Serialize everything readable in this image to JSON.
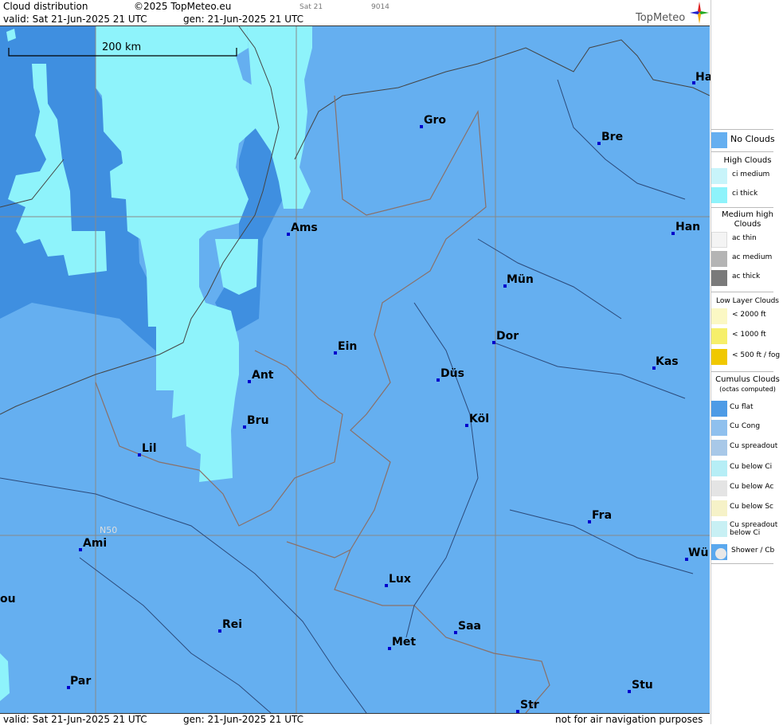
{
  "header": {
    "product": "Cloud distribution",
    "copyright": "©2025 TopMeteo.eu",
    "valid": "valid:  Sat  21-Jun-2025  21 UTC",
    "generated": "gen: 21-Jun-2025 21 UTC",
    "day_small": "Sat 21",
    "code_small": "9014",
    "brand": "TopMeteo"
  },
  "footer": {
    "valid": "valid:  Sat  21-Jun-2025  21 UTC",
    "generated": "gen: 21-Jun-2025 21 UTC",
    "disclaimer": "not for air navigation purposes"
  },
  "map": {
    "scale_label": "200 km",
    "latitude_label": "N50",
    "colors": {
      "no_clouds": "#65aff0",
      "ci_thick": "#8ef3fb",
      "deep": "#3f8fe0",
      "border": "#8a7068",
      "river": "#2c4a7a"
    },
    "cities": [
      {
        "name": "Ha"
      },
      {
        "name": "Gro"
      },
      {
        "name": "Bre"
      },
      {
        "name": "Ams"
      },
      {
        "name": "Han"
      },
      {
        "name": "Mün"
      },
      {
        "name": "Dor"
      },
      {
        "name": "Ein"
      },
      {
        "name": "Kas"
      },
      {
        "name": "Ant"
      },
      {
        "name": "Düs"
      },
      {
        "name": "Köl"
      },
      {
        "name": "Bru"
      },
      {
        "name": "Lil"
      },
      {
        "name": "Fra"
      },
      {
        "name": "Ami"
      },
      {
        "name": "Wü"
      },
      {
        "name": "Lux"
      },
      {
        "name": "ou"
      },
      {
        "name": "Rei"
      },
      {
        "name": "Saa"
      },
      {
        "name": "Met"
      },
      {
        "name": "Stu"
      },
      {
        "name": "Par"
      },
      {
        "name": "Str"
      }
    ]
  },
  "legend": {
    "no_clouds": "No Clouds",
    "high_clouds": "High Clouds",
    "ci_medium": "ci medium",
    "ci_thick": "ci thick",
    "medium_high_1": "Medium high",
    "medium_high_2": "Clouds",
    "ac_thin": "ac thin",
    "ac_medium": "ac medium",
    "ac_thick": "ac thick",
    "low_layer": "Low Layer Clouds",
    "low_2000": "< 2000 ft",
    "low_1000": "< 1000 ft",
    "low_500": "< 500 ft / fog",
    "cumulus_1": "Cumulus Clouds",
    "cumulus_2": "(octas computed)",
    "cu_flat": "Cu flat",
    "cu_cong": "Cu Cong",
    "cu_spreadout": "Cu spreadout",
    "cu_below_ci": "Cu below Ci",
    "cu_below_ac": "Cu below Ac",
    "cu_below_sc": "Cu below Sc",
    "cu_spread_below_1": "Cu spreadout",
    "cu_spread_below_2": "below Ci",
    "shower": "Shower / Cb"
  }
}
